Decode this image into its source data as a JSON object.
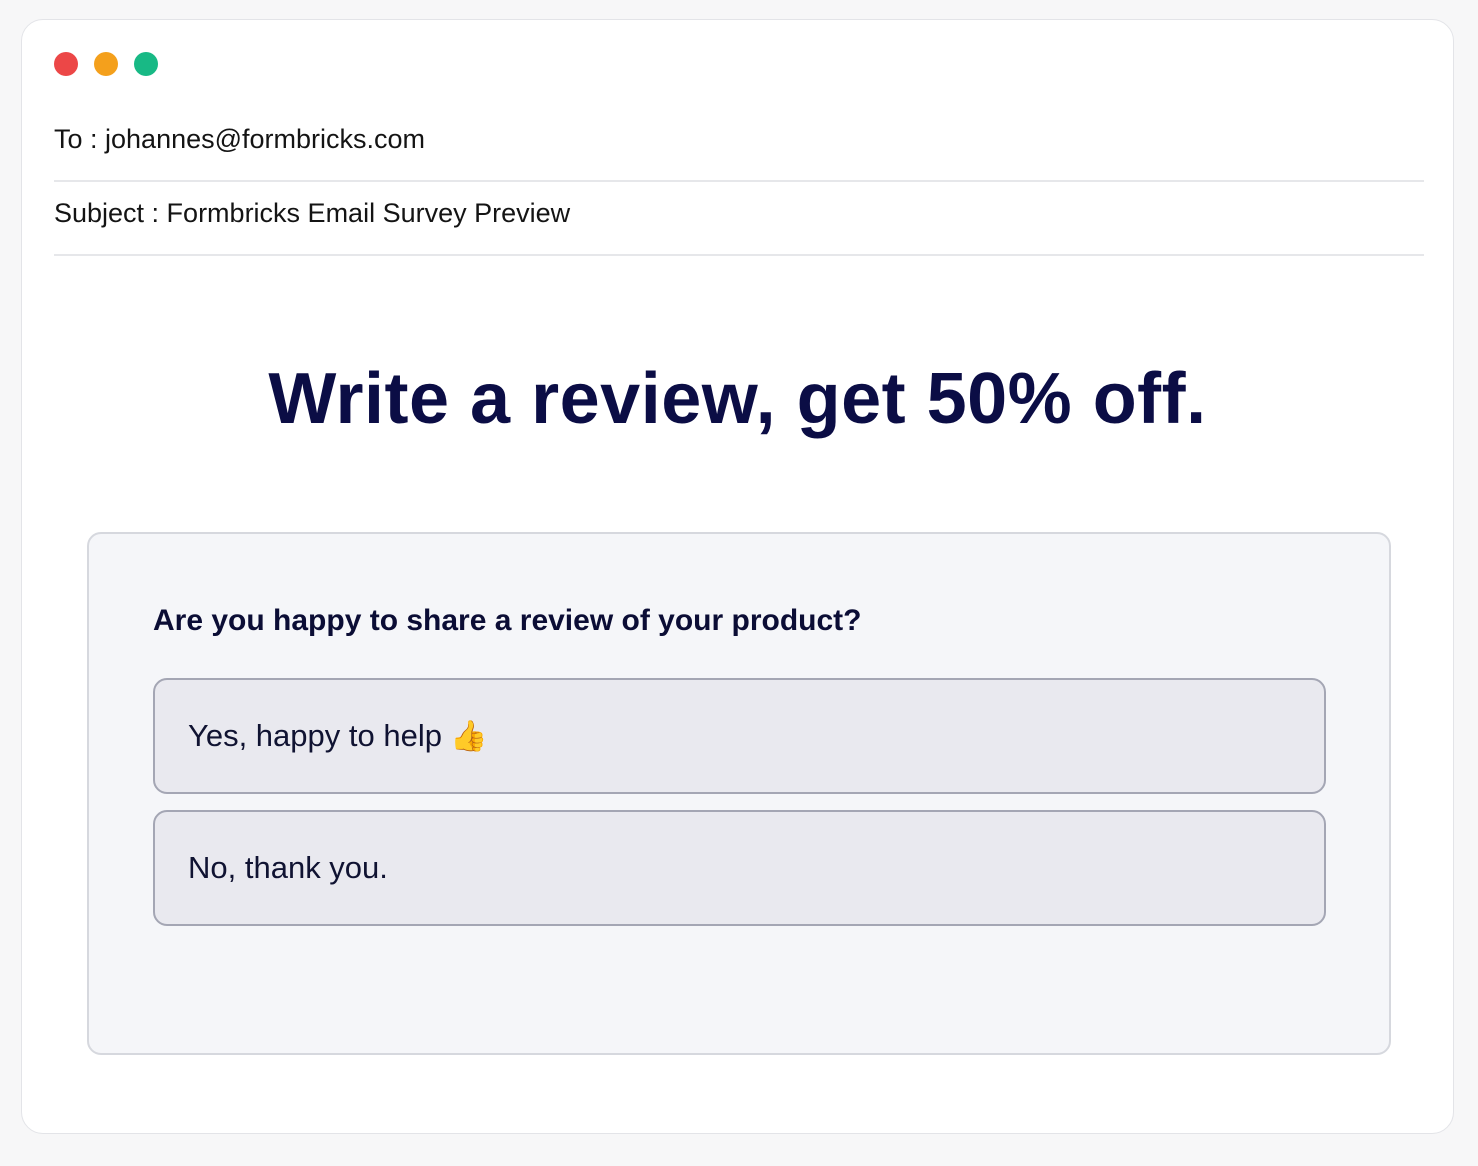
{
  "window_controls": {
    "close_color": "#ec4747",
    "minimize_color": "#f4a01c",
    "maximize_color": "#18b985"
  },
  "email": {
    "to_text": "To : johannes@formbricks.com",
    "subject_text": "Subject : Formbricks Email Survey Preview"
  },
  "content": {
    "headline": "Write a review, get 50% off.",
    "question": "Are you happy to share a review of your product?",
    "options": [
      {
        "label": "Yes, happy to help",
        "icon": "thumbs-up-icon",
        "icon_glyph": "👍"
      },
      {
        "label": "No, thank you."
      }
    ]
  }
}
